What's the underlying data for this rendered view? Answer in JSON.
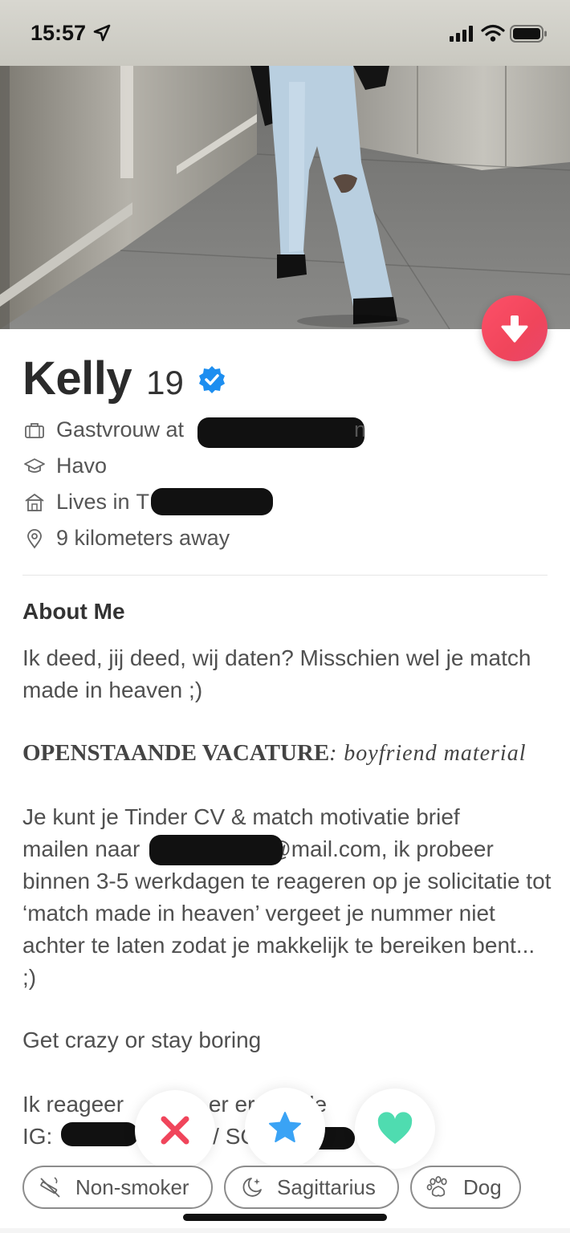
{
  "status_bar": {
    "time": "15:57"
  },
  "profile": {
    "name": "Kelly",
    "age": "19",
    "verified": true,
    "job_prefix": "Gastvrouw at",
    "job_tail": "n",
    "school": "Havo",
    "lives_prefix": "Lives in",
    "lives_tail": "T",
    "distance": "9 kilometers away"
  },
  "about": {
    "title": "About Me",
    "intro": "Ik deed, jij deed, wij daten? Misschien wel je match made in heaven ;)",
    "vacancy_bold": "OPENSTAANDE VACATURE",
    "vacancy_colon": ":",
    "vacancy_italic": "boyfriend material",
    "body_line1": "Je kunt je Tinder CV & match motivatie brief",
    "body_mail_prefix": "mailen naar",
    "body_mail_suffix": "@mail.com, ik probeer",
    "body_rest": "binnen 3-5 werkdagen te reageren op je solicitatie tot ‘match made in heaven’ vergeet je nummer niet achter te laten zodat je makkelijk te bereiken bent... ;)",
    "motto": "Get crazy or stay boring",
    "partial_line1_a": "Ik reageer",
    "partial_line1_b": "er erg",
    "partial_line1_c": "ande",
    "partial_line2_a": "IG:",
    "partial_line2_b": "l",
    "partial_line2_c": "/ SC"
  },
  "chips": [
    {
      "label": "Non-smoker",
      "icon": "no-smoking-icon"
    },
    {
      "label": "Sagittarius",
      "icon": "moon-stars-icon"
    },
    {
      "label": "Dog",
      "icon": "paw-icon"
    }
  ],
  "colors": {
    "brand_gradient_start": "#fd5068",
    "nope": "#f0455b",
    "super_like": "#3aa3f5",
    "like": "#4fdcb0",
    "verified": "#1d8ef0"
  }
}
